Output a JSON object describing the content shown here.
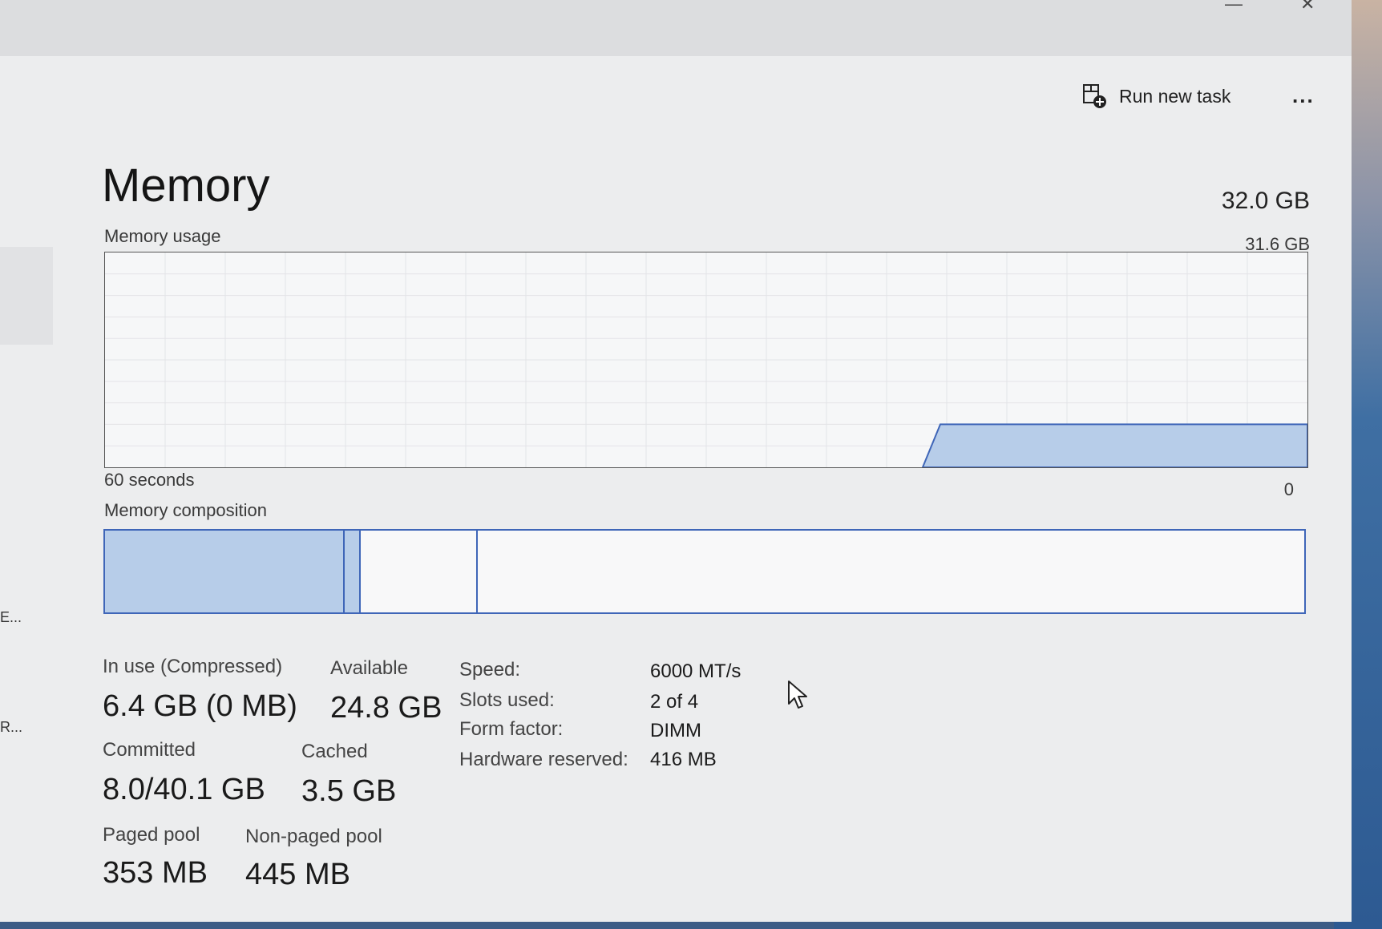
{
  "toolbar": {
    "run_new_task_label": "Run new task",
    "more_label": "..."
  },
  "page": {
    "title": "Memory",
    "total": "32.0 GB"
  },
  "sidebar_fragments": [
    "E...",
    "R..."
  ],
  "usage_chart": {
    "label": "Memory usage",
    "max_label": "31.6 GB",
    "time_label": "60 seconds",
    "min_label": "0",
    "fill_fraction": 0.2,
    "fill_start_fraction": 0.68
  },
  "composition": {
    "label": "Memory composition",
    "in_use_fraction": 0.2,
    "modified_fraction": 0.013,
    "standby_fraction": 0.098
  },
  "stats": {
    "in_use_label": "In use (Compressed)",
    "in_use_value": "6.4 GB (0 MB)",
    "available_label": "Available",
    "available_value": "24.8 GB",
    "committed_label": "Committed",
    "committed_value": "8.0/40.1 GB",
    "cached_label": "Cached",
    "cached_value": "3.5 GB",
    "paged_label": "Paged pool",
    "paged_value": "353 MB",
    "nonpaged_label": "Non-paged pool",
    "nonpaged_value": "445 MB"
  },
  "details": {
    "speed_label": "Speed:",
    "speed_value": "6000 MT/s",
    "slots_label": "Slots used:",
    "slots_value": "2 of 4",
    "form_label": "Form factor:",
    "form_value": "DIMM",
    "hw_label": "Hardware reserved:",
    "hw_value": "416 MB"
  },
  "colors": {
    "accent": "#3f66b8",
    "fill": "#b7cde9"
  }
}
